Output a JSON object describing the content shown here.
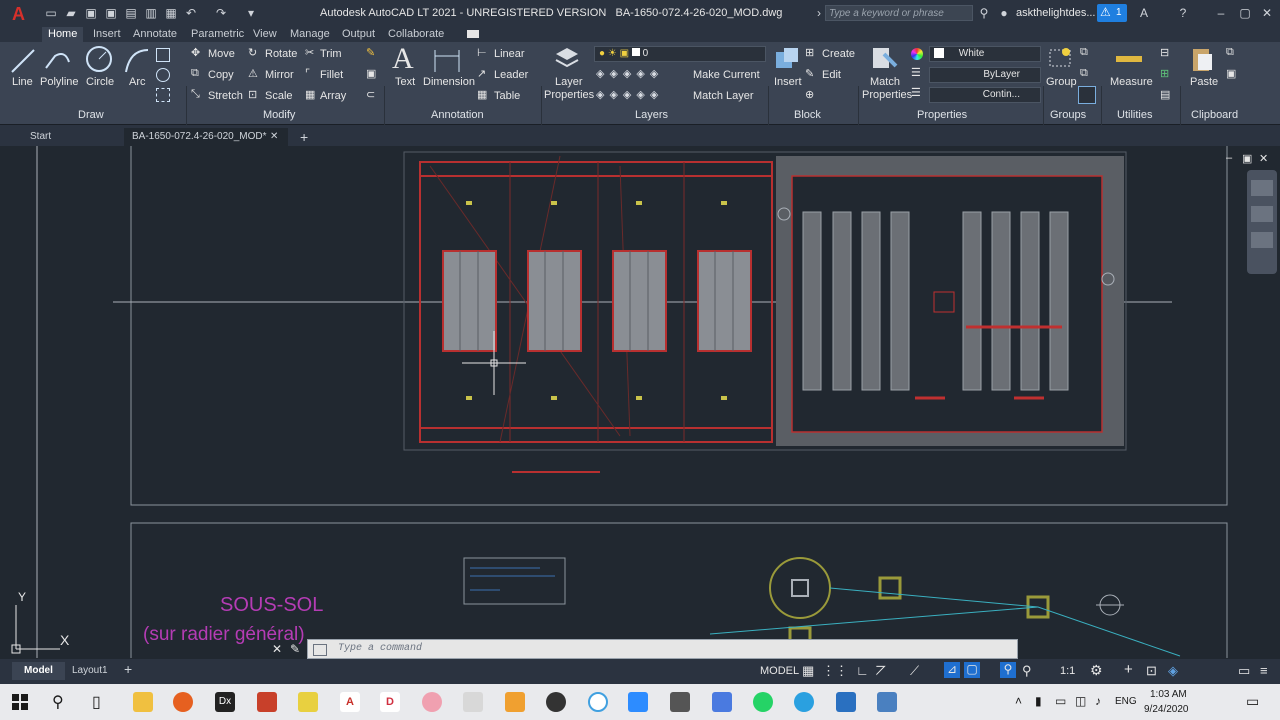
{
  "titlebar": {
    "app_title": "Autodesk AutoCAD LT 2021 - UNREGISTERED VERSION",
    "file_title": "BA-1650-072.4-26-020_MOD.dwg",
    "search_placeholder": "Type a keyword or phrase",
    "user": "askthelightdes...",
    "alert_count": "1"
  },
  "menu_tabs": [
    "Home",
    "Insert",
    "Annotate",
    "Parametric",
    "View",
    "Manage",
    "Output",
    "Collaborate"
  ],
  "ribbon": {
    "draw": {
      "title": "Draw",
      "line": "Line",
      "polyline": "Polyline",
      "circle": "Circle",
      "arc": "Arc"
    },
    "modify": {
      "title": "Modify",
      "move": "Move",
      "rotate": "Rotate",
      "trim": "Trim",
      "copy": "Copy",
      "mirror": "Mirror",
      "fillet": "Fillet",
      "stretch": "Stretch",
      "scale": "Scale",
      "array": "Array"
    },
    "annotation": {
      "title": "Annotation",
      "text": "Text",
      "dimension": "Dimension",
      "linear": "Linear",
      "leader": "Leader",
      "table": "Table"
    },
    "layers": {
      "title": "Layers",
      "layer_properties": "Layer Properties",
      "layer_name": "0",
      "make_current": "Make Current",
      "match_layer": "Match Layer"
    },
    "block": {
      "title": "Block",
      "insert": "Insert",
      "create": "Create",
      "edit": "Edit"
    },
    "properties": {
      "title": "Properties",
      "match_properties": "Match Properties",
      "color": "White",
      "linetype": "ByLayer",
      "lineweight": "Contin..."
    },
    "groups": {
      "title": "Groups",
      "group": "Group"
    },
    "utilities": {
      "title": "Utilities",
      "measure": "Measure"
    },
    "clipboard": {
      "title": "Clipboard",
      "paste": "Paste"
    }
  },
  "file_tabs": {
    "start": "Start",
    "active": "BA-1650-072.4-26-020_MOD*"
  },
  "drawing": {
    "label_main": "SOUS-SOL",
    "label_sub": "(sur radier général)",
    "ucs_y": "Y",
    "ucs_x": "X"
  },
  "command": {
    "placeholder": "Type a command"
  },
  "layout_tabs": [
    "Model",
    "Layout1"
  ],
  "status": {
    "mode": "MODEL",
    "scale": "1:1"
  },
  "taskbar": {
    "lang": "ENG",
    "time": "1:03 AM",
    "date": "9/24/2020"
  },
  "colors": {
    "accent": "#c0392b",
    "ribbon": "#3b4453",
    "canvas": "#212830",
    "label": "#c03cc0"
  }
}
